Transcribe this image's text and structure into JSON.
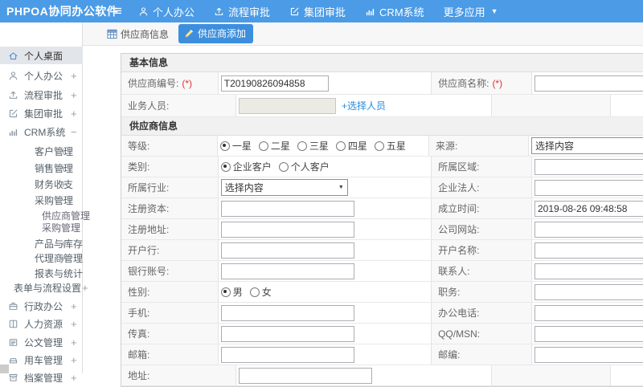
{
  "app": {
    "logo": "PHPOA协同办公软件"
  },
  "topbar": {
    "nav": [
      {
        "icon": "user-icon",
        "label": "个人办公"
      },
      {
        "icon": "upload-icon",
        "label": "流程审批"
      },
      {
        "icon": "edit-icon",
        "label": "集团审批"
      },
      {
        "icon": "chart-icon",
        "label": "CRM系统"
      },
      {
        "icon": "",
        "label": "更多应用",
        "caret": true
      }
    ]
  },
  "sidebar": {
    "items": [
      {
        "label": "个人桌面",
        "level": 0,
        "icon": "home-icon",
        "active": true
      },
      {
        "label": "个人办公",
        "level": 0,
        "icon": "user-icon",
        "expand": "+"
      },
      {
        "label": "流程审批",
        "level": 0,
        "icon": "upload-icon",
        "expand": "+"
      },
      {
        "label": "集团审批",
        "level": 0,
        "icon": "edit-icon",
        "expand": "+"
      },
      {
        "label": "CRM系统",
        "level": 0,
        "icon": "chart-icon",
        "expand": "−"
      },
      {
        "label": "客户管理",
        "level": 1,
        "expand": "+"
      },
      {
        "label": "销售管理",
        "level": 1,
        "expand": "+"
      },
      {
        "label": "财务收支",
        "level": 1,
        "expand": "+"
      },
      {
        "label": "采购管理",
        "level": 1,
        "expand": "−"
      },
      {
        "label": "供应商管理",
        "level": 2
      },
      {
        "label": "采购管理",
        "level": 2
      },
      {
        "label": "产品与库存",
        "level": 1,
        "expand": "+"
      },
      {
        "label": "代理商管理",
        "level": 1,
        "expand": "+"
      },
      {
        "label": "报表与统计",
        "level": 1
      },
      {
        "label": "表单与流程设置",
        "level": 1,
        "expand": "+",
        "tight": true
      },
      {
        "label": "行政办公",
        "level": 0,
        "icon": "briefcase-icon",
        "expand": "+"
      },
      {
        "label": "人力资源",
        "level": 0,
        "icon": "book-icon",
        "expand": "+"
      },
      {
        "label": "公文管理",
        "level": 0,
        "icon": "document-icon",
        "expand": "+"
      },
      {
        "label": "用车管理",
        "level": 0,
        "icon": "car-icon",
        "expand": "+"
      },
      {
        "label": "档案管理",
        "level": 0,
        "icon": "archive-icon",
        "expand": "+"
      }
    ]
  },
  "tabs": [
    {
      "icon": "table-icon",
      "label": "供应商信息",
      "active": false
    },
    {
      "icon": "pencil-icon",
      "label": "供应商添加",
      "active": true
    }
  ],
  "form": {
    "required_marker": "(*)",
    "sections": [
      {
        "title": "基本信息",
        "rows": [
          {
            "left": {
              "label": "供应商编号:",
              "required": true,
              "field": {
                "type": "text",
                "value": "T20190826094858",
                "width": 126
              }
            },
            "right": {
              "label": "供应商名称:",
              "required": true,
              "field": {
                "type": "text",
                "value": "",
                "width": 158
              }
            }
          },
          {
            "left": {
              "label": "业务人员:",
              "field": {
                "type": "text-disabled",
                "value": "",
                "width": 113
              },
              "link": "+选择人员"
            },
            "right": {
              "label": "",
              "field": {
                "type": "none"
              }
            }
          }
        ]
      },
      {
        "title": "供应商信息",
        "rows": [
          {
            "left": {
              "label": "等级:",
              "field": {
                "type": "radios",
                "options": [
                  "一星",
                  "二星",
                  "三星",
                  "四星",
                  "五星"
                ],
                "checked": 0
              }
            },
            "right": {
              "label": "来源:",
              "field": {
                "type": "select",
                "value": "选择内容",
                "width": 160
              }
            }
          },
          {
            "left": {
              "label": "类别:",
              "field": {
                "type": "radios",
                "options": [
                  "企业客户",
                  "个人客户"
                ],
                "checked": 0
              }
            },
            "right": {
              "label": "所属区域:",
              "field": {
                "type": "text",
                "value": "",
                "width": 158
              }
            }
          },
          {
            "left": {
              "label": "所属行业:",
              "field": {
                "type": "select",
                "value": "选择内容",
                "width": 148
              }
            },
            "right": {
              "label": "企业法人:",
              "field": {
                "type": "text",
                "value": "",
                "width": 158
              }
            }
          },
          {
            "left": {
              "label": "注册资本:",
              "field": {
                "type": "text",
                "value": "",
                "width": 158
              }
            },
            "right": {
              "label": "成立时间:",
              "field": {
                "type": "text",
                "value": "2019-08-26 09:48:58",
                "width": 158
              }
            }
          },
          {
            "left": {
              "label": "注册地址:",
              "field": {
                "type": "text",
                "value": "",
                "width": 158
              }
            },
            "right": {
              "label": "公司网站:",
              "field": {
                "type": "text",
                "value": "",
                "width": 158
              }
            }
          },
          {
            "left": {
              "label": "开户行:",
              "field": {
                "type": "text",
                "value": "",
                "width": 158
              }
            },
            "right": {
              "label": "开户名称:",
              "field": {
                "type": "text",
                "value": "",
                "width": 158
              }
            }
          },
          {
            "left": {
              "label": "银行账号:",
              "field": {
                "type": "text",
                "value": "",
                "width": 158
              }
            },
            "right": {
              "label": "联系人:",
              "field": {
                "type": "text",
                "value": "",
                "width": 158
              }
            }
          },
          {
            "left": {
              "label": "性别:",
              "field": {
                "type": "radios",
                "options": [
                  "男",
                  "女"
                ],
                "checked": 0
              }
            },
            "right": {
              "label": "职务:",
              "field": {
                "type": "text",
                "value": "",
                "width": 158
              }
            }
          },
          {
            "left": {
              "label": "手机:",
              "field": {
                "type": "text",
                "value": "",
                "width": 158
              }
            },
            "right": {
              "label": "办公电话:",
              "field": {
                "type": "text",
                "value": "",
                "width": 158
              }
            }
          },
          {
            "left": {
              "label": "传真:",
              "field": {
                "type": "text",
                "value": "",
                "width": 158
              }
            },
            "right": {
              "label": "QQ/MSN:",
              "field": {
                "type": "text",
                "value": "",
                "width": 158
              }
            }
          },
          {
            "left": {
              "label": "邮箱:",
              "field": {
                "type": "text",
                "value": "",
                "width": 158
              }
            },
            "right": {
              "label": "邮编:",
              "field": {
                "type": "text",
                "value": "",
                "width": 158
              }
            }
          },
          {
            "left": {
              "label": "地址:",
              "field": {
                "type": "text",
                "value": "",
                "width": 158
              }
            },
            "right": {
              "label": "",
              "field": {
                "type": "none"
              }
            }
          }
        ]
      }
    ]
  },
  "colors": {
    "topbar": "#4b9be6",
    "active_tab": "#3d8fdd",
    "link": "#2a8ce0",
    "required": "#e33030",
    "sidebar_active_bg": "#e2e6ea",
    "icon_blue": "#4a90d9"
  }
}
